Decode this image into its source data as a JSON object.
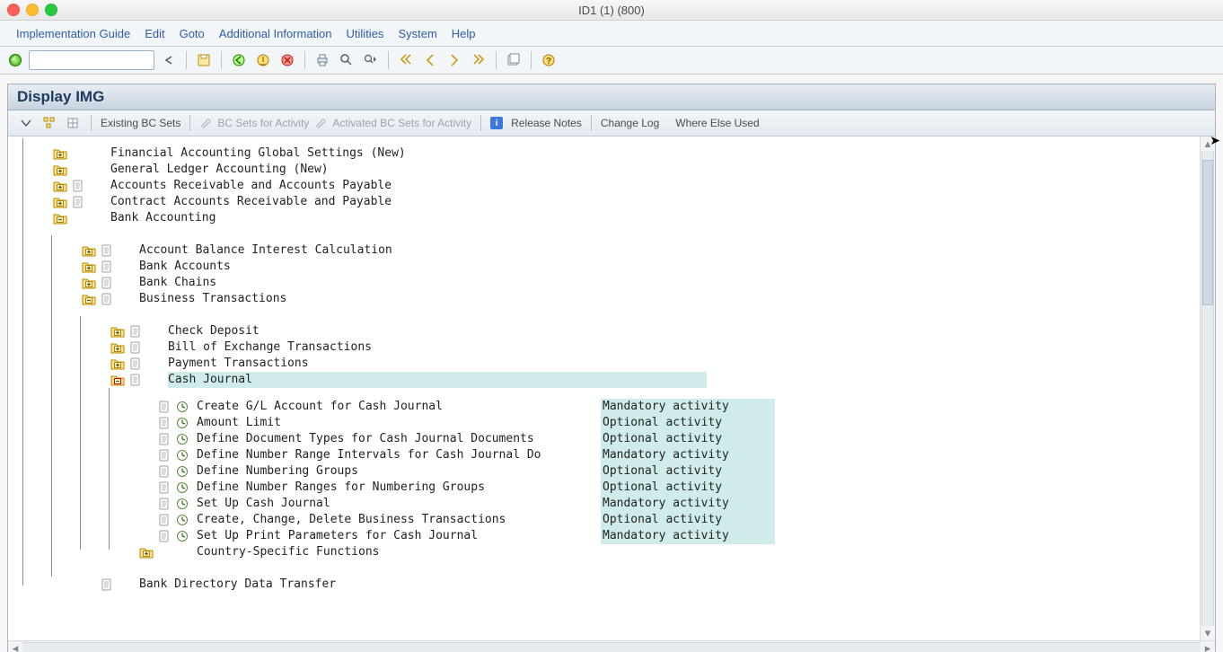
{
  "window": {
    "title": "ID1 (1) (800)"
  },
  "menu": {
    "items": [
      "Implementation Guide",
      "Edit",
      "Goto",
      "Additional Information",
      "Utilities",
      "System",
      "Help"
    ]
  },
  "subwindow": {
    "title": "Display IMG"
  },
  "subtoolbar": {
    "existing_bc_sets": "Existing BC Sets",
    "bc_sets_for_activity": "BC Sets for Activity",
    "activated_bc_sets": "Activated BC Sets for Activity",
    "release_notes": "Release Notes",
    "change_log": "Change Log",
    "where_else_used": "Where Else Used"
  },
  "tree": {
    "rows": [
      {
        "depth": 0,
        "folder": "plus",
        "doc": false,
        "clock": false,
        "label": "Financial Accounting Global Settings (New)",
        "status": ""
      },
      {
        "depth": 0,
        "folder": "plus",
        "doc": false,
        "clock": false,
        "label": "General Ledger Accounting (New)",
        "status": ""
      },
      {
        "depth": 0,
        "folder": "plus",
        "doc": true,
        "clock": false,
        "label": "Accounts Receivable and Accounts Payable",
        "status": ""
      },
      {
        "depth": 0,
        "folder": "plus",
        "doc": true,
        "clock": false,
        "label": "Contract Accounts Receivable and Payable",
        "status": ""
      },
      {
        "depth": 0,
        "folder": "minus",
        "doc": false,
        "clock": false,
        "label": "Bank Accounting",
        "status": ""
      },
      {
        "depth": 1,
        "folder": "plus",
        "doc": true,
        "clock": false,
        "label": "Account Balance Interest Calculation",
        "status": ""
      },
      {
        "depth": 1,
        "folder": "plus",
        "doc": true,
        "clock": false,
        "label": "Bank Accounts",
        "status": ""
      },
      {
        "depth": 1,
        "folder": "plus",
        "doc": true,
        "clock": false,
        "label": "Bank Chains",
        "status": ""
      },
      {
        "depth": 1,
        "folder": "minus",
        "doc": true,
        "clock": false,
        "label": "Business Transactions",
        "status": ""
      },
      {
        "depth": 2,
        "folder": "plus",
        "doc": true,
        "clock": false,
        "label": "Check Deposit",
        "status": ""
      },
      {
        "depth": 2,
        "folder": "plus",
        "doc": true,
        "clock": false,
        "label": "Bill of Exchange Transactions",
        "status": ""
      },
      {
        "depth": 2,
        "folder": "plus",
        "doc": true,
        "clock": false,
        "label": "Payment Transactions",
        "status": ""
      },
      {
        "depth": 2,
        "folder": "open",
        "doc": true,
        "clock": false,
        "label": "Cash Journal",
        "selected": true,
        "status": ""
      },
      {
        "depth": 3,
        "folder": "",
        "doc": true,
        "clock": true,
        "label": "Create G/L Account for Cash Journal",
        "status": "Mandatory activity",
        "hl": true
      },
      {
        "depth": 3,
        "folder": "",
        "doc": true,
        "clock": true,
        "label": "Amount Limit",
        "status": "Optional activity",
        "hl": true
      },
      {
        "depth": 3,
        "folder": "",
        "doc": true,
        "clock": true,
        "label": "Define Document Types for Cash Journal Documents",
        "status": "Optional activity",
        "hl": true
      },
      {
        "depth": 3,
        "folder": "",
        "doc": true,
        "clock": true,
        "label": "Define Number Range Intervals for Cash Journal Do",
        "status": "Mandatory activity",
        "hl": true
      },
      {
        "depth": 3,
        "folder": "",
        "doc": true,
        "clock": true,
        "label": "Define Numbering Groups",
        "status": "Optional activity",
        "hl": true
      },
      {
        "depth": 3,
        "folder": "",
        "doc": true,
        "clock": true,
        "label": "Define Number Ranges for Numbering Groups",
        "status": "Optional activity",
        "hl": true
      },
      {
        "depth": 3,
        "folder": "",
        "doc": true,
        "clock": true,
        "label": "Set Up Cash Journal",
        "status": "Mandatory activity",
        "hl": true
      },
      {
        "depth": 3,
        "folder": "",
        "doc": true,
        "clock": true,
        "label": "Create, Change, Delete Business Transactions",
        "status": "Optional activity",
        "hl": true
      },
      {
        "depth": 3,
        "folder": "",
        "doc": true,
        "clock": true,
        "label": "Set Up Print Parameters for Cash Journal",
        "status": "Mandatory activity",
        "hl": true
      },
      {
        "depth": 3,
        "folder": "plus",
        "doc": false,
        "clock": false,
        "label": "Country-Specific Functions",
        "status": ""
      },
      {
        "depth": 1,
        "folder": "",
        "doc": true,
        "clock": false,
        "label": "Bank Directory Data Transfer",
        "status": ""
      }
    ]
  }
}
